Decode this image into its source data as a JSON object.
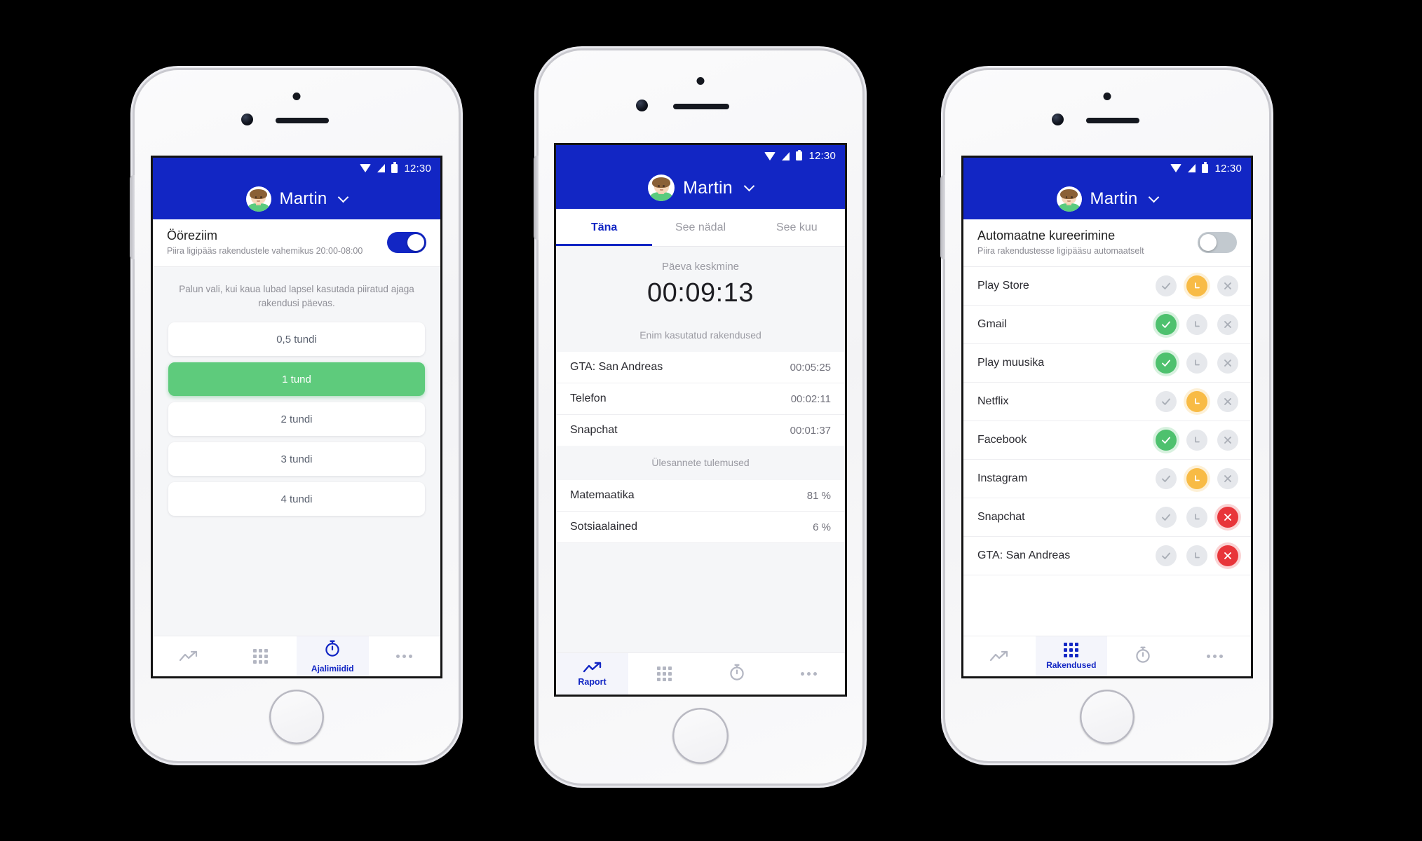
{
  "user": {
    "name": "Martin"
  },
  "statusbar": {
    "time": "12:30",
    "wifi_icon": "wifi-icon",
    "signal_icon": "signal-icon",
    "battery_icon": "battery-icon"
  },
  "phone1": {
    "night_mode": {
      "title": "Ööreziim",
      "subtitle": "Piira ligipääs rakendustele vahemikus 20:00-08:00",
      "toggle_state": "on"
    },
    "hint": "Palun vali, kui kaua lubad lapsel kasutada piiratud ajaga rakendusi päevas.",
    "options": [
      {
        "label": "0,5 tundi",
        "selected": false
      },
      {
        "label": "1 tund",
        "selected": true
      },
      {
        "label": "2 tundi",
        "selected": false
      },
      {
        "label": "3 tundi",
        "selected": false
      },
      {
        "label": "4 tundi",
        "selected": false
      }
    ],
    "nav": [
      {
        "icon": "trend-icon",
        "label": "",
        "active": false
      },
      {
        "icon": "grid-icon",
        "label": "",
        "active": false
      },
      {
        "icon": "stopwatch-icon",
        "label": "Ajalimiidid",
        "active": true
      },
      {
        "icon": "more-icon",
        "label": "",
        "active": false
      }
    ]
  },
  "phone2": {
    "tabs": [
      {
        "label": "Täna",
        "active": true
      },
      {
        "label": "See nädal",
        "active": false
      },
      {
        "label": "See kuu",
        "active": false
      }
    ],
    "average": {
      "label": "Päeva keskmine",
      "value": "00:09:13"
    },
    "most_used_header": "Enim kasutatud rakendused",
    "most_used": [
      {
        "name": "GTA: San Andreas",
        "value": "00:05:25"
      },
      {
        "name": "Telefon",
        "value": "00:02:11"
      },
      {
        "name": "Snapchat",
        "value": "00:01:37"
      }
    ],
    "tasks_header": "Ülesannete tulemused",
    "tasks": [
      {
        "name": "Matemaatika",
        "value": "81 %"
      },
      {
        "name": "Sotsiaalained",
        "value": "6 %"
      }
    ],
    "nav": [
      {
        "icon": "trend-icon",
        "label": "Raport",
        "active": true
      },
      {
        "icon": "grid-icon",
        "label": "",
        "active": false
      },
      {
        "icon": "stopwatch-icon",
        "label": "",
        "active": false
      },
      {
        "icon": "more-icon",
        "label": "",
        "active": false
      }
    ]
  },
  "phone3": {
    "auto_curate": {
      "title": "Automaatne kureerimine",
      "subtitle": "Piira rakendustesse ligipääsu automaatselt",
      "toggle_state": "off"
    },
    "apps": [
      {
        "name": "Play Store",
        "state": "amber"
      },
      {
        "name": "Gmail",
        "state": "green"
      },
      {
        "name": "Play muusika",
        "state": "green"
      },
      {
        "name": "Netflix",
        "state": "amber"
      },
      {
        "name": "Facebook",
        "state": "green"
      },
      {
        "name": "Instagram",
        "state": "amber"
      },
      {
        "name": "Snapchat",
        "state": "red"
      },
      {
        "name": "GTA: San Andreas",
        "state": "red"
      }
    ],
    "action_icons": [
      "check-icon",
      "clock-icon",
      "close-icon"
    ],
    "nav": [
      {
        "icon": "trend-icon",
        "label": "",
        "active": false
      },
      {
        "icon": "grid-icon",
        "label": "Rakendused",
        "active": true
      },
      {
        "icon": "stopwatch-icon",
        "label": "",
        "active": false
      },
      {
        "icon": "more-icon",
        "label": "",
        "active": false
      }
    ]
  },
  "colors": {
    "brand_blue": "#1226c4",
    "green": "#5ecb7c",
    "amber": "#f8bb45",
    "red": "#e8353a",
    "background": "#000000"
  }
}
